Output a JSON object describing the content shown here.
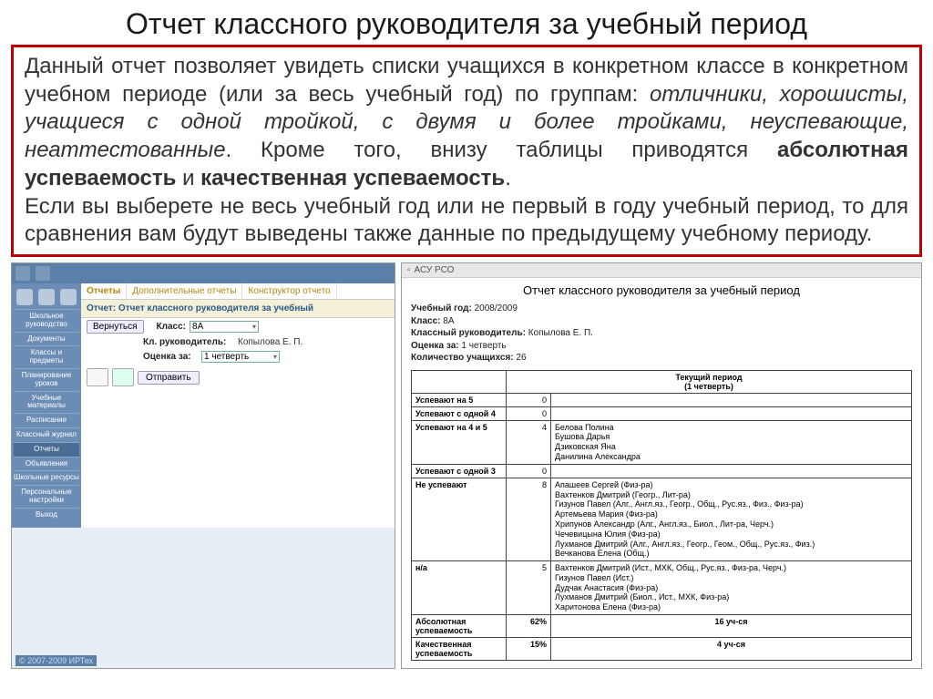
{
  "title": "Отчет классного руководителя за учебный период",
  "description": {
    "p1_a": "Данный отчет позволяет увидеть списки учащихся в конкретном классе в конкретном учебном периоде (или за весь учебный год) по группам: ",
    "italics": "отличники, хорошисты, учащиеся с одной тройкой, с двумя и более тройками, неуспевающие, неаттестованные",
    "p1_b": ". Кроме того, внизу таблицы приводятся ",
    "bold1": "абсолютная успеваемость",
    "and": " и ",
    "bold2": "качественная успеваемость",
    "period": ".",
    "p2": "Если вы выберете не весь учебный год или не первый в году учебный период, то для сравнения вам будут выведены также данные по предыдущему учебному периоду."
  },
  "left": {
    "tabs": [
      "Отчеты",
      "Дополнительные отчеты",
      "Конструктор отчето"
    ],
    "report_label": "Отчет:",
    "report_name": "Отчет классного руководителя за учебный",
    "back": "Вернуться",
    "class_label": "Класс:",
    "class_value": "8А",
    "teacher_label": "Кл. руководитель:",
    "teacher_value": "Копылова Е. П.",
    "grade_label": "Оценка за:",
    "grade_value": "1 четверть",
    "send": "Отправить",
    "sidebar": [
      "Школьное руководство",
      "Документы",
      "Классы и предметы",
      "Планирование уроков",
      "Учебные материалы",
      "Расписание",
      "Классный журнал",
      "Отчеты",
      "Объявления",
      "Школьные ресурсы",
      "Персональные настройки",
      "Выход"
    ],
    "copyright": "© 2007-2009 ИРТех"
  },
  "right": {
    "window": "АСУ РСО",
    "title": "Отчет классного руководителя за учебный период",
    "meta": {
      "year_l": "Учебный год:",
      "year_v": "2008/2009",
      "class_l": "Класс:",
      "class_v": "8А",
      "teacher_l": "Классный руководитель:",
      "teacher_v": "Копылова Е. П.",
      "grade_l": "Оценка за:",
      "grade_v": "1 четверть",
      "count_l": "Количество учащихся:",
      "count_v": "26"
    },
    "period_header": "Текущий период",
    "period_sub": "(1 четверть)",
    "rows": [
      {
        "label": "Успевают на 5",
        "n": "0",
        "names": ""
      },
      {
        "label": "Успевают с одной 4",
        "n": "0",
        "names": ""
      },
      {
        "label": "Успевают на 4 и 5",
        "n": "4",
        "names": "Белова Полина\nБушова Дарья\nДзиковская Яна\nДанилина Александра"
      },
      {
        "label": "Успевают с одной 3",
        "n": "0",
        "names": ""
      },
      {
        "label": "Не успевают",
        "n": "8",
        "names": "Апашеев Сергей (Физ-ра)\nВахтенков Дмитрий (Геогр., Лит-ра)\nГизунов Павел (Алг., Англ.яз., Геогр., Общ., Рус.яз., Физ., Физ-ра)\nАртемьева Мария (Физ-ра)\nХрипунов Александр (Алг., Англ.яз., Биол., Лит-ра, Черч.)\nЧечевицына Юлия (Физ-ра)\nЛухманов Дмитрий (Алг., Англ.яз., Геогр., Геом., Общ., Рус.яз., Физ.)\nВечканова Елена (Общ.)"
      },
      {
        "label": "н/а",
        "n": "5",
        "names": "Вахтенков Дмитрий (Ист., МХК, Общ., Рус.яз., Физ-ра, Черч.)\nГизунов Павел (Ист.)\nДудчак Анастасия (Физ-ра)\nЛухманов Дмитрий (Биол., Ист., МХК, Физ-ра)\nХаритонова Елена (Физ-ра)"
      }
    ],
    "foot": [
      {
        "label": "Абсолютная успеваемость",
        "pct": "62%",
        "val": "16 уч-ся"
      },
      {
        "label": "Качественная успеваемость",
        "pct": "15%",
        "val": "4 уч-ся"
      }
    ]
  }
}
